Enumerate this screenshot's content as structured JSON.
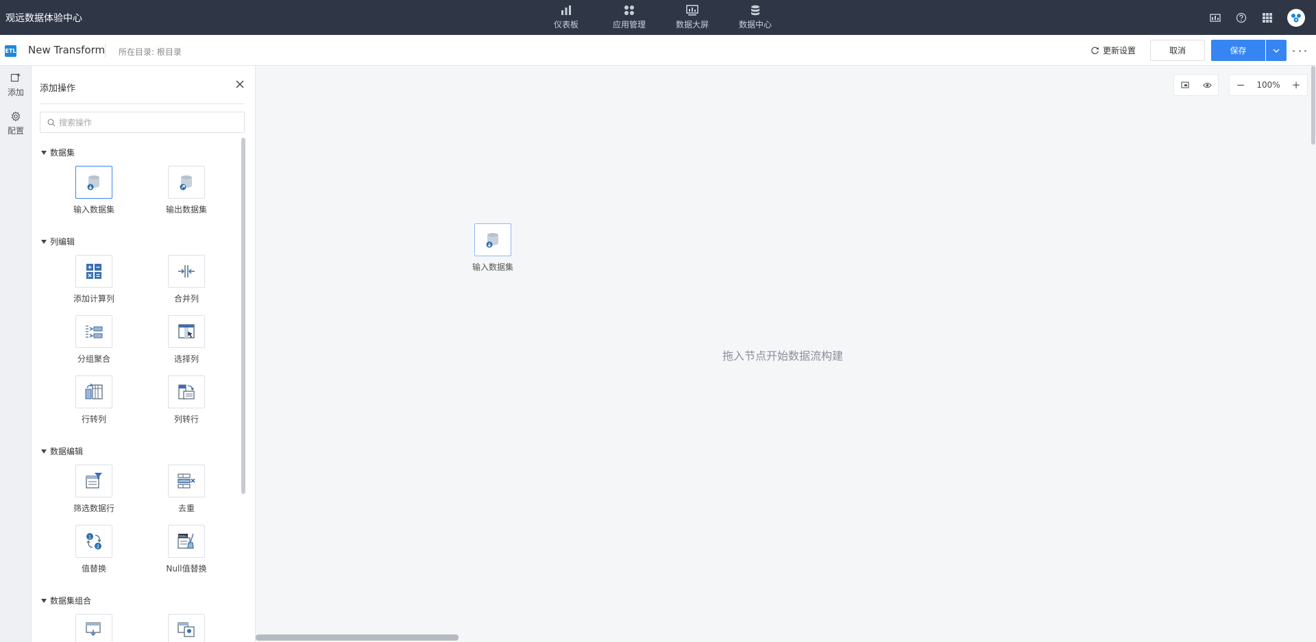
{
  "app": {
    "brand": "观远数据体验中心"
  },
  "topnav": [
    {
      "label": "仪表板",
      "icon": "bar-chart-icon"
    },
    {
      "label": "应用管理",
      "icon": "apps-icon"
    },
    {
      "label": "数据大屏",
      "icon": "screen-icon"
    },
    {
      "label": "数据中心",
      "icon": "database-icon"
    }
  ],
  "topicons": [
    "display-icon",
    "help-icon",
    "grid-icon",
    "avatar"
  ],
  "toolbar": {
    "badge": "ETL",
    "title": "New Transform",
    "dir_label": "所在目录:",
    "dir_value": "根目录",
    "refresh_label": "更新设置",
    "cancel_label": "取消",
    "save_label": "保存"
  },
  "rail": {
    "add_label": "添加",
    "config_label": "配置"
  },
  "panel": {
    "title": "添加操作",
    "search_placeholder": "搜索操作",
    "sections": [
      {
        "title": "数据集",
        "items": [
          "输入数据集",
          "输出数据集"
        ]
      },
      {
        "title": "列编辑",
        "items": [
          "添加计算列",
          "合并列",
          "分组聚合",
          "选择列",
          "行转列",
          "列转行"
        ]
      },
      {
        "title": "数据编辑",
        "items": [
          "筛选数据行",
          "去重",
          "值替换",
          "Null值替换"
        ]
      },
      {
        "title": "数据集组合",
        "items": []
      }
    ]
  },
  "canvas": {
    "zoom": "100%",
    "node_label": "输入数据集",
    "hint": "拖入节点开始数据流构建"
  },
  "colors": {
    "topbar": "#2f3747",
    "accent": "#3685f2",
    "badge": "#1e88d8"
  }
}
